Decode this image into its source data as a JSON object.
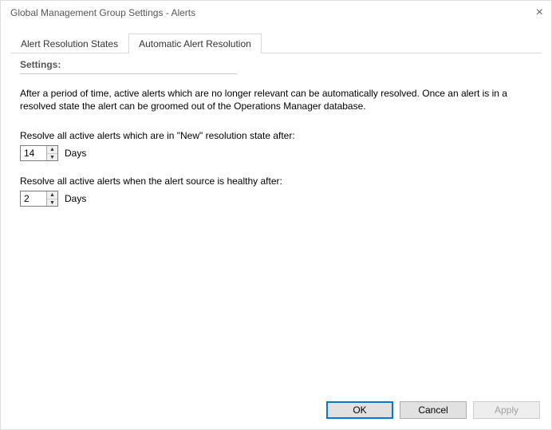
{
  "window": {
    "title": "Global Management Group Settings - Alerts"
  },
  "tabs": {
    "inactive": {
      "label": "Alert Resolution States"
    },
    "active": {
      "label": "Automatic Alert Resolution"
    }
  },
  "panel": {
    "heading": "Settings:",
    "description": "After a period of time, active alerts which are no longer relevant can be automatically resolved. Once an alert is in a resolved state the alert can be groomed out of the Operations Manager database.",
    "field1": {
      "label": "Resolve all active alerts which are in \"New\" resolution state after:",
      "value": "14",
      "units": "Days"
    },
    "field2": {
      "label": "Resolve all active alerts when the alert source is healthy after:",
      "value": "2",
      "units": "Days"
    }
  },
  "buttons": {
    "ok": "OK",
    "cancel": "Cancel",
    "apply": "Apply"
  }
}
